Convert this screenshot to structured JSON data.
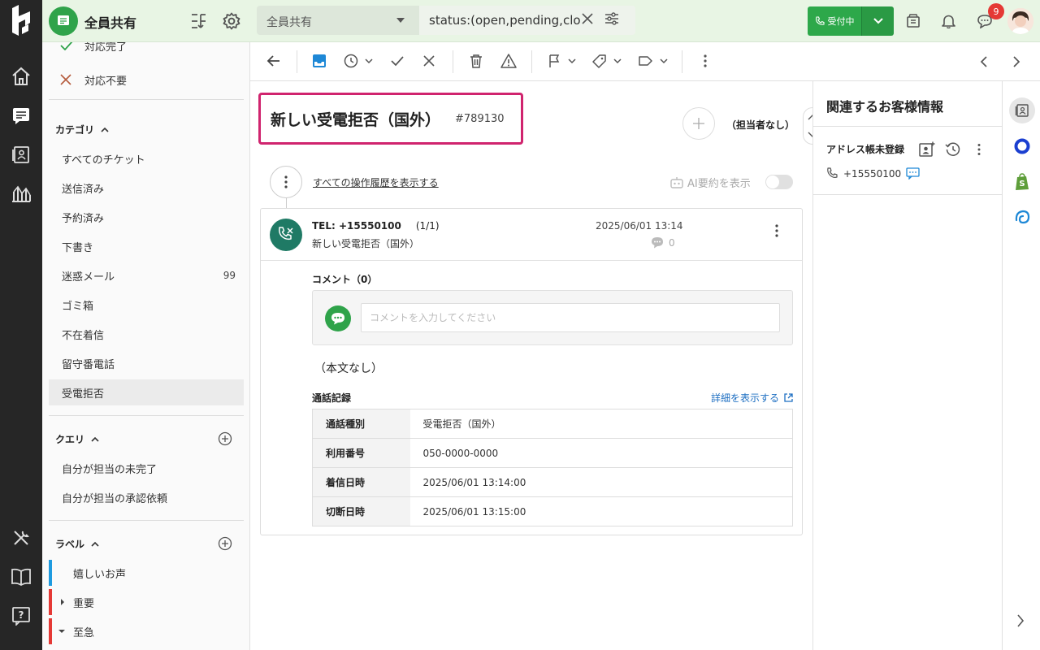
{
  "rail": {
    "items": [
      "home",
      "tickets",
      "contacts",
      "reports",
      "tools",
      "guide",
      "help"
    ]
  },
  "topbar": {
    "inbox_title": "全員共有",
    "view_select": "全員共有",
    "search_query": "status:(open,pending,clo",
    "status_label": "受付中",
    "notification_count": "9"
  },
  "sidebar": {
    "status_items": [
      {
        "label": "対応完了"
      },
      {
        "label": "対応不要"
      }
    ],
    "category_heading": "カテゴリ",
    "categories": [
      {
        "label": "すべてのチケット",
        "count": ""
      },
      {
        "label": "送信済み",
        "count": ""
      },
      {
        "label": "予約済み",
        "count": ""
      },
      {
        "label": "下書き",
        "count": ""
      },
      {
        "label": "迷惑メール",
        "count": "99"
      },
      {
        "label": "ゴミ箱",
        "count": ""
      },
      {
        "label": "不在着信",
        "count": ""
      },
      {
        "label": "留守番電話",
        "count": ""
      },
      {
        "label": "受電拒否",
        "count": "",
        "active": true
      }
    ],
    "query_heading": "クエリ",
    "queries": [
      {
        "label": "自分が担当の未完了"
      },
      {
        "label": "自分が担当の承認依頼"
      }
    ],
    "label_heading": "ラベル",
    "labels": [
      {
        "label": "嬉しいお声",
        "color": "#1e9be0"
      },
      {
        "label": "重要",
        "color": "#e53935"
      },
      {
        "label": "至急",
        "color": "#e53935"
      }
    ]
  },
  "ticket": {
    "title": "新しい受電拒否（国外）",
    "id": "#789130",
    "assignee": "（担当者なし）",
    "history_link": "すべての操作履歴を表示する",
    "ai_summary_label": "AI要約を表示"
  },
  "message": {
    "from": "TEL: +15550100",
    "count": "(1/1)",
    "subject": "新しい受電拒否（国外）",
    "time": "2025/06/01 13:14",
    "comment_count": "0"
  },
  "comments": {
    "title": "コメント（0）",
    "placeholder": "コメントを入力してください"
  },
  "body_text": "（本文なし）",
  "call_log": {
    "title": "通話記録",
    "detail_link": "詳細を表示する",
    "rows": [
      {
        "key": "通話種別",
        "value": "受電拒否（国外）"
      },
      {
        "key": "利用番号",
        "value": "050-0000-0000"
      },
      {
        "key": "着信日時",
        "value": "2025/06/01 13:14:00"
      },
      {
        "key": "切断日時",
        "value": "2025/06/01 13:15:00"
      }
    ]
  },
  "customer_panel": {
    "title": "関連するお客様情報",
    "address_status": "アドレス帳未登録",
    "phone": "+15550100"
  },
  "colors": {
    "brand_green": "#2fa34a",
    "highlight": "#d0246e",
    "link": "#1e6fc2",
    "call_icon": "#1f7a65"
  }
}
